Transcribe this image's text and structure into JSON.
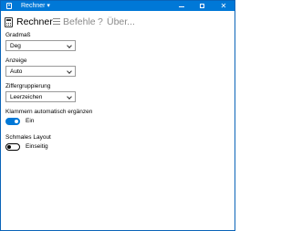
{
  "titlebar": {
    "title": "Rechner ▾",
    "minimize_icon": "minimize-icon",
    "maximize_icon": "maximize-icon",
    "close_icon": "close-icon",
    "close_glyph": "✕",
    "accent_color": "#0078d7"
  },
  "nav": {
    "items": [
      {
        "label": "Rechner",
        "icon": "calculator-icon",
        "selected": true
      },
      {
        "label": "Befehle",
        "icon": "list-icon",
        "selected": false
      },
      {
        "label": "Über...",
        "icon": "question-icon",
        "selected": false
      }
    ],
    "question_glyph": "?"
  },
  "settings": {
    "gradmass": {
      "label": "Gradmaß",
      "value": "Deg"
    },
    "anzeige": {
      "label": "Anzeige",
      "value": "Auto"
    },
    "ziffern": {
      "label": "Ziffergruppierung",
      "value": "Leerzeichen"
    },
    "klammern": {
      "label": "Klammern automatisch ergänzen",
      "state_label": "Ein",
      "on": true
    },
    "layout": {
      "label": "Schmales Layout",
      "state_label": "Einseitig",
      "on": false
    }
  }
}
